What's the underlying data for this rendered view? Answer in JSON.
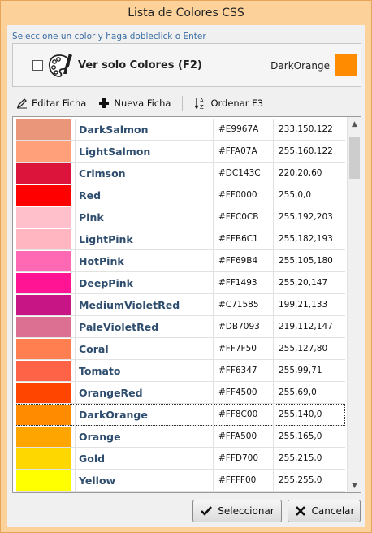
{
  "window": {
    "title": "Lista de Colores CSS"
  },
  "hint": "Seleccione un color y haga dobleclick o Enter",
  "filter": {
    "checkbox_label": "Ver solo Colores (F2)",
    "checked": false
  },
  "selected": {
    "name": "DarkOrange",
    "color": "#FF8C00"
  },
  "toolbar": {
    "edit_label": "Editar Ficha",
    "new_label": "Nueva Ficha",
    "sort_label": "Ordenar F3"
  },
  "grid": {
    "rows": [
      {
        "name": "DarkSalmon",
        "hex": "#E9967A",
        "rgb": "233,150,122",
        "color": "#E9967A"
      },
      {
        "name": "LightSalmon",
        "hex": "#FFA07A",
        "rgb": "255,160,122",
        "color": "#FFA07A"
      },
      {
        "name": "Crimson",
        "hex": "#DC143C",
        "rgb": "220,20,60",
        "color": "#DC143C"
      },
      {
        "name": "Red",
        "hex": "#FF0000",
        "rgb": "255,0,0",
        "color": "#FF0000"
      },
      {
        "name": "Pink",
        "hex": "#FFC0CB",
        "rgb": "255,192,203",
        "color": "#FFC0CB"
      },
      {
        "name": "LightPink",
        "hex": "#FFB6C1",
        "rgb": "255,182,193",
        "color": "#FFB6C1"
      },
      {
        "name": "HotPink",
        "hex": "#FF69B4",
        "rgb": "255,105,180",
        "color": "#FF69B4"
      },
      {
        "name": "DeepPink",
        "hex": "#FF1493",
        "rgb": "255,20,147",
        "color": "#FF1493"
      },
      {
        "name": "MediumVioletRed",
        "hex": "#C71585",
        "rgb": "199,21,133",
        "color": "#C71585"
      },
      {
        "name": "PaleVioletRed",
        "hex": "#DB7093",
        "rgb": "219,112,147",
        "color": "#DB7093"
      },
      {
        "name": "Coral",
        "hex": "#FF7F50",
        "rgb": "255,127,80",
        "color": "#FF7F50"
      },
      {
        "name": "Tomato",
        "hex": "#FF6347",
        "rgb": "255,99,71",
        "color": "#FF6347"
      },
      {
        "name": "OrangeRed",
        "hex": "#FF4500",
        "rgb": "255,69,0",
        "color": "#FF4500"
      },
      {
        "name": "DarkOrange",
        "hex": "#FF8C00",
        "rgb": "255,140,0",
        "color": "#FF8C00",
        "selected": true
      },
      {
        "name": "Orange",
        "hex": "#FFA500",
        "rgb": "255,165,0",
        "color": "#FFA500"
      },
      {
        "name": "Gold",
        "hex": "#FFD700",
        "rgb": "255,215,0",
        "color": "#FFD700"
      },
      {
        "name": "Yellow",
        "hex": "#FFFF00",
        "rgb": "255,255,0",
        "color": "#FFFF00"
      }
    ]
  },
  "buttons": {
    "select_label": "Seleccionar",
    "cancel_label": "Cancelar"
  }
}
